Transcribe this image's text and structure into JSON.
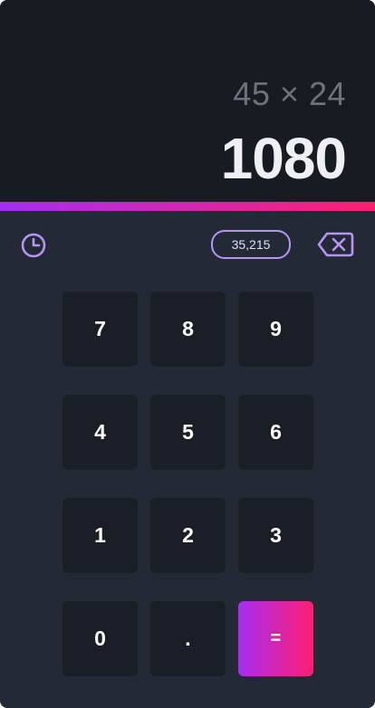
{
  "display": {
    "expression": "45 × 24",
    "result": "1080"
  },
  "toolbar": {
    "history_icon": "clock-icon",
    "memory_value": "35,215",
    "backspace_icon": "backspace-icon"
  },
  "keypad": {
    "rows": [
      [
        "7",
        "8",
        "9"
      ],
      [
        "4",
        "5",
        "6"
      ],
      [
        "1",
        "2",
        "3"
      ],
      [
        "0",
        ".",
        "="
      ]
    ]
  },
  "colors": {
    "display_bg": "#171b22",
    "panel_bg": "#232a35",
    "key_bg": "#1a1f27",
    "accent_start": "#a52ef2",
    "accent_end": "#ff1f6f",
    "icon_purple": "#b695f5"
  }
}
